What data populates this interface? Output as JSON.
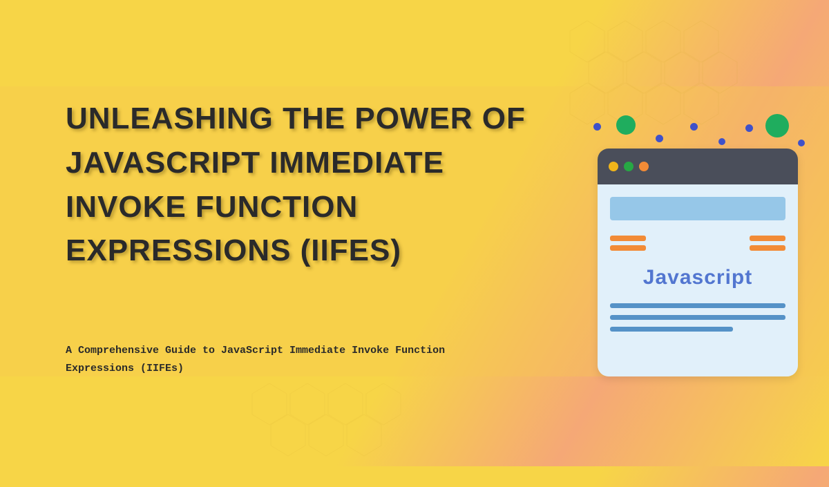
{
  "title": "UNLEASHING THE POWER OF JAVASCRIPT IMMEDIATE INVOKE FUNCTION EXPRESSIONS (IIFES)",
  "subtitle": "A Comprehensive Guide to JavaScript Immediate Invoke Function Expressions (IIFEs)",
  "browser": {
    "label": "Javascript"
  }
}
